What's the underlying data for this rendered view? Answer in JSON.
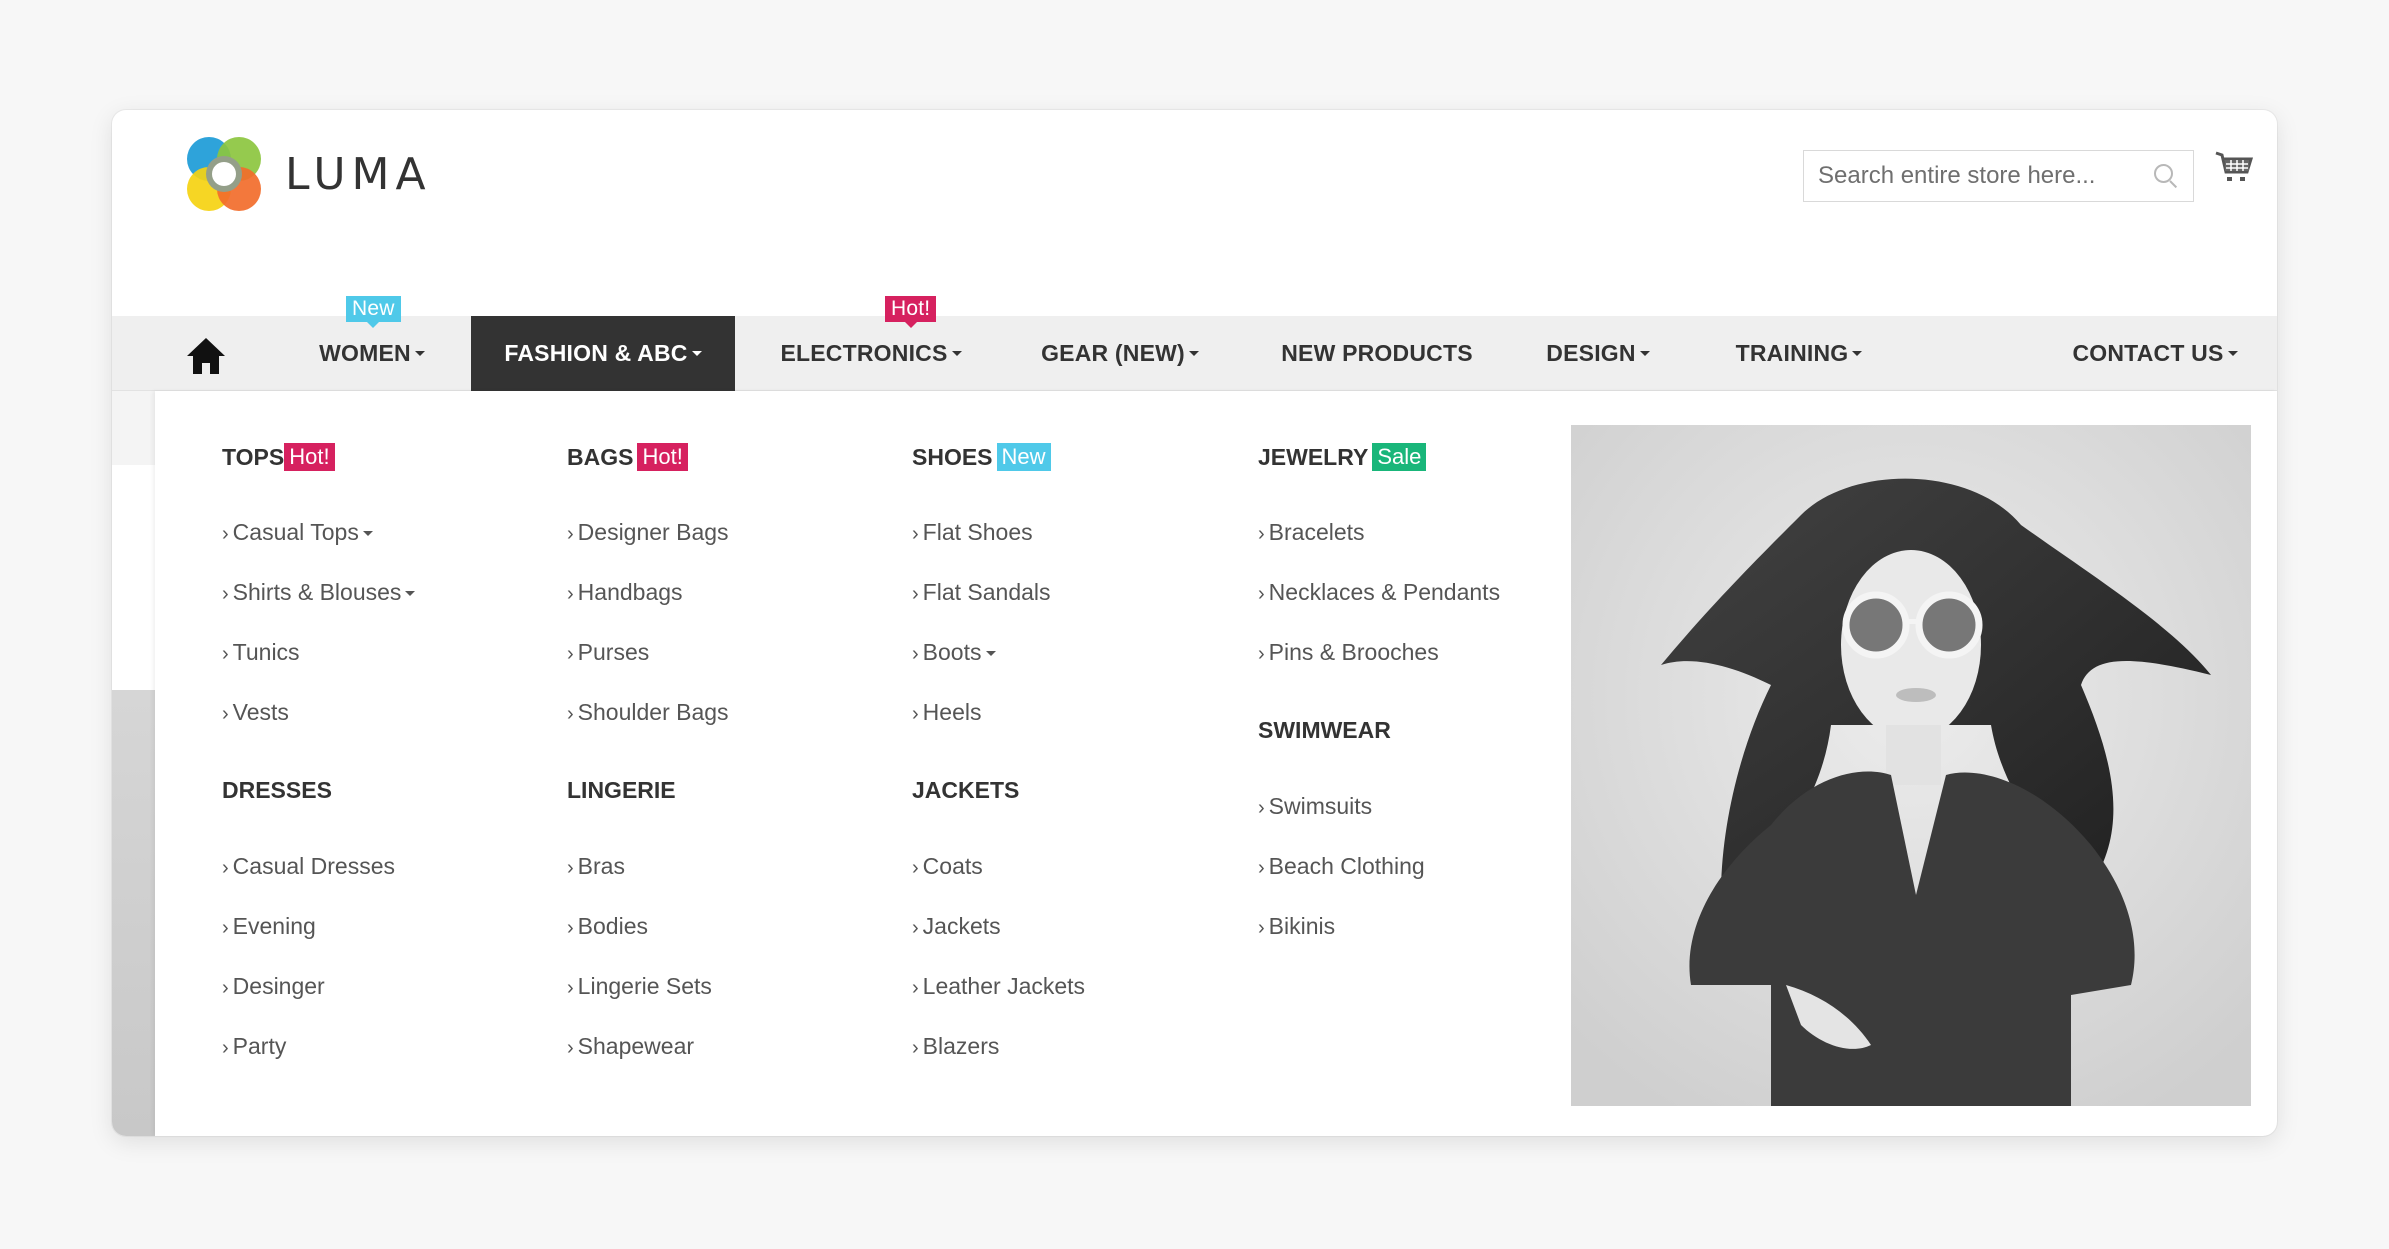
{
  "brand": {
    "name": "LUMA"
  },
  "search": {
    "placeholder": "Search entire store here..."
  },
  "nav": {
    "home_label": "Home",
    "items": [
      {
        "label": "WOMEN",
        "dropdown": true,
        "badge": "New"
      },
      {
        "label": "FASHION & ABC",
        "dropdown": true,
        "active": true
      },
      {
        "label": "ELECTRONICS",
        "dropdown": true,
        "badge": "Hot!"
      },
      {
        "label": "GEAR (NEW)",
        "dropdown": true
      },
      {
        "label": "NEW PRODUCTS",
        "dropdown": false
      },
      {
        "label": "DESIGN",
        "dropdown": true
      },
      {
        "label": "TRAINING",
        "dropdown": true
      },
      {
        "label": "CONTACT US",
        "dropdown": true
      }
    ]
  },
  "megamenu": {
    "columns": [
      {
        "groups": [
          {
            "title": "TOPS",
            "badge": "Hot!",
            "items": [
              "Casual Tops",
              "Shirts & Blouses",
              "Tunics",
              "Vests"
            ]
          },
          {
            "title": "DRESSES",
            "items": [
              "Casual Dresses",
              "Evening",
              "Desinger",
              "Party"
            ]
          }
        ]
      },
      {
        "groups": [
          {
            "title": "BAGS",
            "badge": "Hot!",
            "items": [
              "Designer Bags",
              "Handbags",
              "Purses",
              "Shoulder Bags"
            ]
          },
          {
            "title": "LINGERIE",
            "items": [
              "Bras",
              "Bodies",
              "Lingerie Sets",
              "Shapewear"
            ]
          }
        ]
      },
      {
        "groups": [
          {
            "title": "SHOES",
            "badge": "New",
            "items": [
              "Flat Shoes",
              "Flat Sandals",
              "Boots",
              "Heels"
            ]
          },
          {
            "title": "JACKETS",
            "items": [
              "Coats",
              "Jackets",
              "Leather Jackets",
              "Blazers"
            ]
          }
        ]
      },
      {
        "groups": [
          {
            "title": "JEWELRY",
            "badge": "Sale",
            "items": [
              "Bracelets",
              "Necklaces & Pendants",
              "Pins & Brooches"
            ]
          },
          {
            "title": "SWIMWEAR",
            "items": [
              "Swimsuits",
              "Beach Clothing",
              "Bikinis"
            ]
          }
        ]
      }
    ],
    "item_prefix": "›",
    "promo_image_alt": "Black and white fashion photo of woman with sunglasses"
  },
  "colors": {
    "hot": "#d6215f",
    "new": "#4fc9e9",
    "sale": "#19b67a",
    "nav_active_bg": "#333333",
    "nav_bg": "#efefef"
  }
}
